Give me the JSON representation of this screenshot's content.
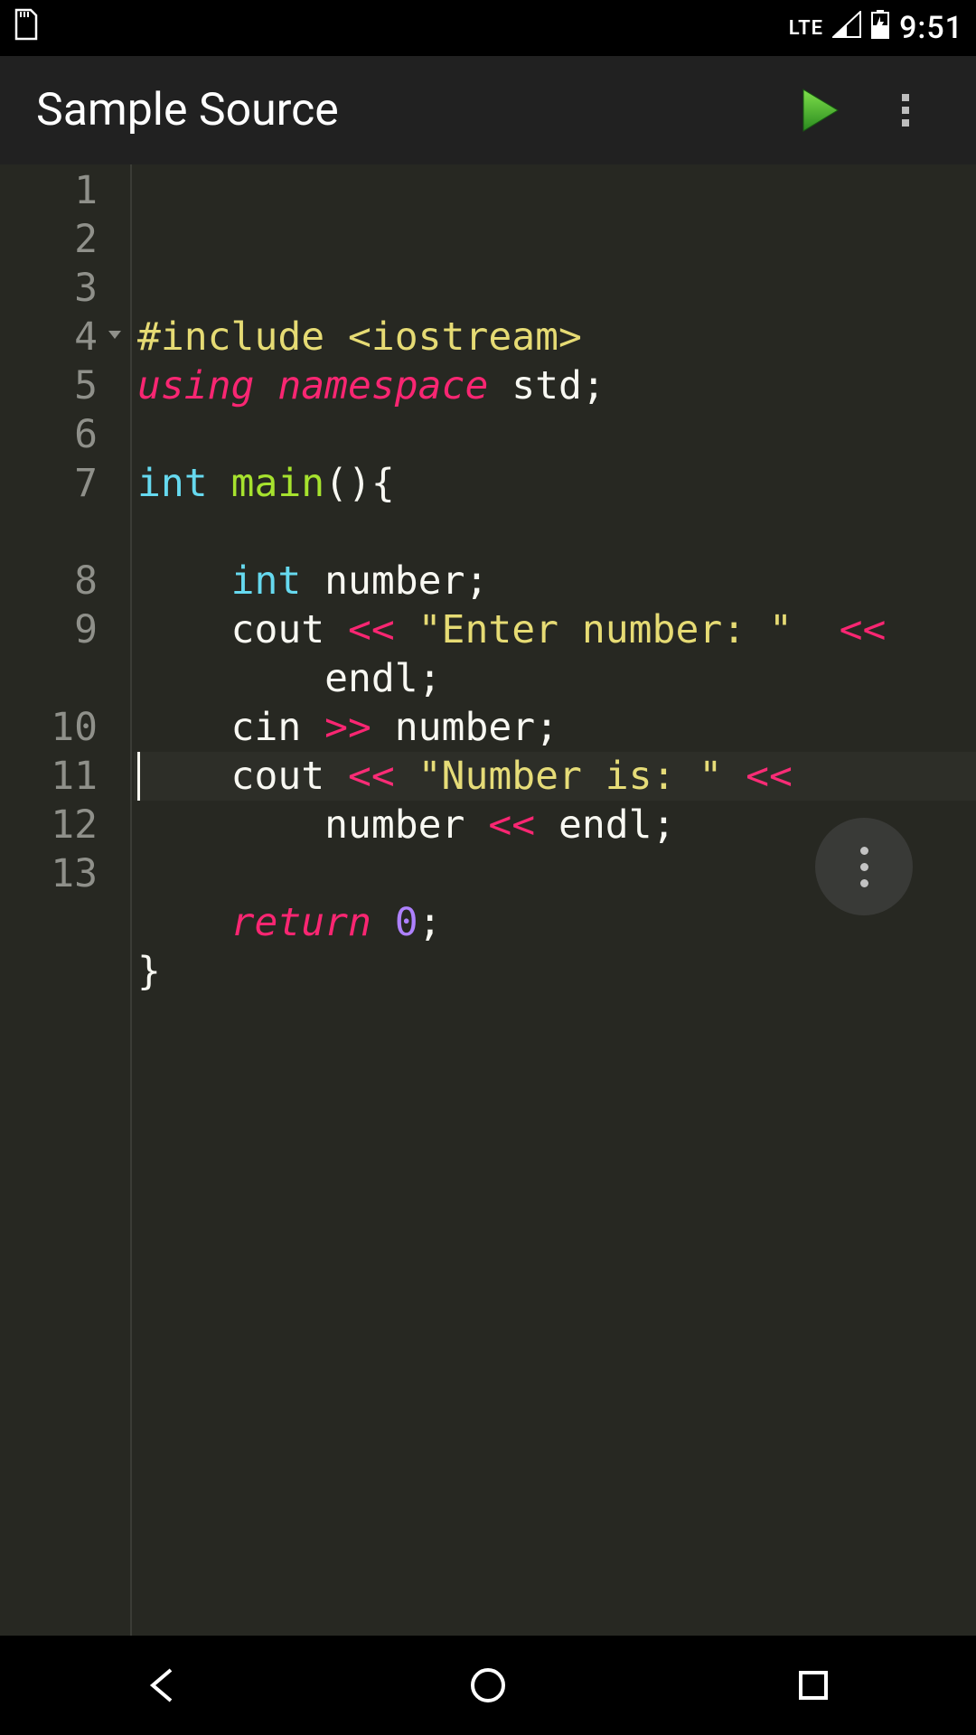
{
  "statusbar": {
    "network_label": "LTE",
    "time": "9:51"
  },
  "appbar": {
    "title": "Sample Source"
  },
  "editor": {
    "line_numbers": [
      "1",
      "2",
      "3",
      "4",
      "5",
      "6",
      "7",
      "8",
      "9",
      "10",
      "11",
      "12",
      "13"
    ],
    "fold_on_line": 4,
    "cursor_line": 13,
    "code_lines": [
      {
        "n": 1,
        "wraps": [
          [
            {
              "t": "#include ",
              "c": "tk-include"
            },
            {
              "t": "<iostream>",
              "c": "tk-anglelib"
            }
          ]
        ]
      },
      {
        "n": 2,
        "wraps": [
          [
            {
              "t": "using",
              "c": "tk-keyword"
            },
            {
              "t": " ",
              "c": "tk-punct"
            },
            {
              "t": "namespace",
              "c": "tk-keyword"
            },
            {
              "t": " ",
              "c": "tk-punct"
            },
            {
              "t": "std",
              "c": "tk-identifier"
            },
            {
              "t": ";",
              "c": "tk-punct"
            }
          ]
        ]
      },
      {
        "n": 3,
        "wraps": [
          [
            {
              "t": "",
              "c": "tk-punct"
            }
          ]
        ]
      },
      {
        "n": 4,
        "wraps": [
          [
            {
              "t": "int",
              "c": "tk-builtin"
            },
            {
              "t": " ",
              "c": "tk-punct"
            },
            {
              "t": "main",
              "c": "tk-func"
            },
            {
              "t": "(){",
              "c": "tk-punct"
            }
          ]
        ]
      },
      {
        "n": 5,
        "wraps": [
          [
            {
              "t": "",
              "c": "tk-punct"
            }
          ]
        ]
      },
      {
        "n": 6,
        "wraps": [
          [
            {
              "t": "    ",
              "c": "tk-punct"
            },
            {
              "t": "int",
              "c": "tk-builtin"
            },
            {
              "t": " number;",
              "c": "tk-punct"
            }
          ]
        ]
      },
      {
        "n": 7,
        "wraps": [
          [
            {
              "t": "    cout ",
              "c": "tk-identifier"
            },
            {
              "t": "<<",
              "c": "tk-operator"
            },
            {
              "t": " ",
              "c": "tk-punct"
            },
            {
              "t": "\"Enter number: \"",
              "c": "tk-string"
            },
            {
              "t": "  ",
              "c": "tk-punct"
            },
            {
              "t": "<<",
              "c": "tk-operator"
            }
          ],
          [
            {
              "t": "        endl;",
              "c": "tk-identifier"
            }
          ]
        ]
      },
      {
        "n": 8,
        "wraps": [
          [
            {
              "t": "    cin ",
              "c": "tk-identifier"
            },
            {
              "t": ">>",
              "c": "tk-operator"
            },
            {
              "t": " number;",
              "c": "tk-identifier"
            }
          ]
        ]
      },
      {
        "n": 9,
        "wraps": [
          [
            {
              "t": "    cout ",
              "c": "tk-identifier"
            },
            {
              "t": "<<",
              "c": "tk-operator"
            },
            {
              "t": " ",
              "c": "tk-punct"
            },
            {
              "t": "\"Number is: \"",
              "c": "tk-string"
            },
            {
              "t": " ",
              "c": "tk-punct"
            },
            {
              "t": "<<",
              "c": "tk-operator"
            }
          ],
          [
            {
              "t": "        number ",
              "c": "tk-identifier"
            },
            {
              "t": "<<",
              "c": "tk-operator"
            },
            {
              "t": " endl;",
              "c": "tk-identifier"
            }
          ]
        ]
      },
      {
        "n": 10,
        "wraps": [
          [
            {
              "t": "",
              "c": "tk-punct"
            }
          ]
        ]
      },
      {
        "n": 11,
        "wraps": [
          [
            {
              "t": "    ",
              "c": "tk-punct"
            },
            {
              "t": "return",
              "c": "tk-keyword"
            },
            {
              "t": " ",
              "c": "tk-punct"
            },
            {
              "t": "0",
              "c": "tk-number"
            },
            {
              "t": ";",
              "c": "tk-punct"
            }
          ]
        ]
      },
      {
        "n": 12,
        "wraps": [
          [
            {
              "t": "}",
              "c": "tk-punct"
            }
          ]
        ]
      },
      {
        "n": 13,
        "wraps": [
          [
            {
              "t": "",
              "c": "tk-punct"
            }
          ]
        ]
      }
    ]
  }
}
